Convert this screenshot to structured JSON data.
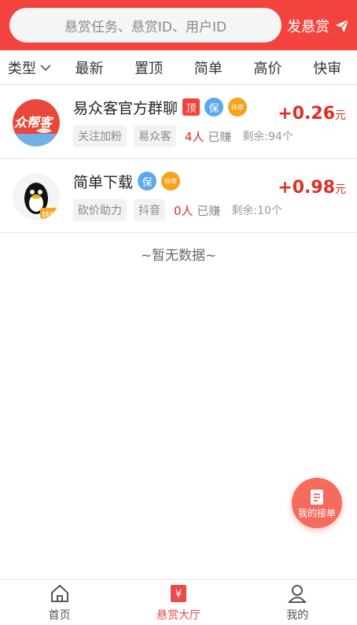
{
  "header": {
    "search_placeholder": "悬赏任务、悬赏ID、用户ID",
    "publish_label": "发悬赏",
    "accent": "#f2433f"
  },
  "filters": [
    {
      "label": "类型",
      "has_dropdown": true
    },
    {
      "label": "最新"
    },
    {
      "label": "置顶"
    },
    {
      "label": "简单"
    },
    {
      "label": "高价"
    },
    {
      "label": "快审"
    }
  ],
  "tasks": [
    {
      "avatar_text": "众帮客",
      "title": "易众客官方群聊",
      "badges": {
        "top": "顶",
        "guarantee": "保",
        "fast": "快审"
      },
      "tags": [
        "关注加粉",
        "易众客"
      ],
      "earned_count": "4人",
      "earned_label": "已赚",
      "remaining": "剩余:94个",
      "price": "+0.26",
      "unit": "元"
    },
    {
      "avatar_badge": "特权",
      "title": "简单下载",
      "badges": {
        "guarantee": "保",
        "fast": "快审"
      },
      "tags": [
        "砍价助力",
        "抖音"
      ],
      "earned_count": "0人",
      "earned_label": "已赚",
      "remaining": "剩余:10个",
      "price": "+0.98",
      "unit": "元"
    }
  ],
  "empty_text": "~暂无数据~",
  "float_button": {
    "label": "我的接单"
  },
  "tabbar": [
    {
      "label": "首页",
      "icon": "home-icon"
    },
    {
      "label": "悬赏大厅",
      "icon": "hall-icon",
      "active": true
    },
    {
      "label": "我的",
      "icon": "user-icon"
    }
  ]
}
